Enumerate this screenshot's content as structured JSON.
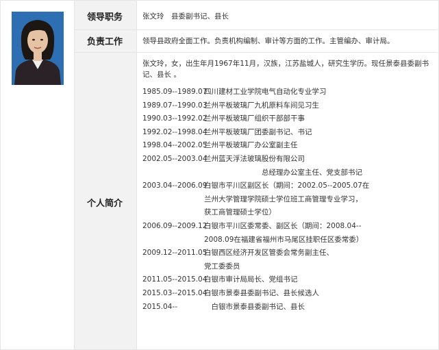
{
  "profile": {
    "photo": {
      "bg_color": "#2e6fb4",
      "hair_color": "#1d1714",
      "skin_color": "#e6c2a4",
      "jacket_color": "#2a2226"
    },
    "rows": {
      "position": {
        "label": "领导职务",
        "value": "张文玲　县委副书记、县长"
      },
      "duty": {
        "label": "负责工作",
        "value": "领导县政府全面工作。负责机构编制、审计等方面的工作。主管编办、审计局。"
      },
      "bio": {
        "label": "个人简介",
        "intro": "张文玲，女，出生年月1967年11月，汉族，江苏盐城人，研究生学历。现任景泰县委副书记、县长 。",
        "entries": [
          {
            "date": "1985.09--1989.07",
            "text": "四川建材工业学院电气自动化专业学习"
          },
          {
            "date": "1989.07--1990.03",
            "text": "兰州平板玻璃厂九机原料车间见习生"
          },
          {
            "date": "1990.03--1992.02",
            "text": "兰州平板玻璃厂组织干部部干事"
          },
          {
            "date": "1992.02--1998.04",
            "text": "兰州平板玻璃厂团委副书记、书记"
          },
          {
            "date": "1998.04--2002.05",
            "text": "兰州平板玻璃厂办公室副主任"
          },
          {
            "date": "2002.05--2003.04",
            "text": "兰州蓝天浮法玻璃股份有限公司"
          },
          {
            "date": "",
            "text": "　　　　　　　　总经理办公室主任、党支部书记"
          },
          {
            "date": "2003.04--2006.09",
            "text": "白银市平川区副区长（期间：2002.05--2005.07在"
          },
          {
            "date": "",
            "text": "兰州大学管理学院硕士学位班工商管理专业学习，"
          },
          {
            "date": "",
            "text": "获工商管理硕士学位）"
          },
          {
            "date": "2006.09--2009.12",
            "text": "白银市平川区委常委、副区长（期间：2008.04--"
          },
          {
            "date": "",
            "text": "2008.09在福建省福州市马尾区挂职任区委常委）"
          },
          {
            "date": "2009.12--2011.05",
            "text": "白银西区经济开发区管委会常务副主任、"
          },
          {
            "date": "",
            "text": "党工委委员"
          },
          {
            "date": "2011.05--2015.04",
            "text": "白银市审计局局长、党组书记"
          },
          {
            "date": "2015.03--2015.04",
            "text": "白银市景泰县委副书记、县长候选人"
          },
          {
            "date": "2015.04--",
            "text": "　白银市景泰县委副书记、县长"
          }
        ]
      }
    }
  }
}
